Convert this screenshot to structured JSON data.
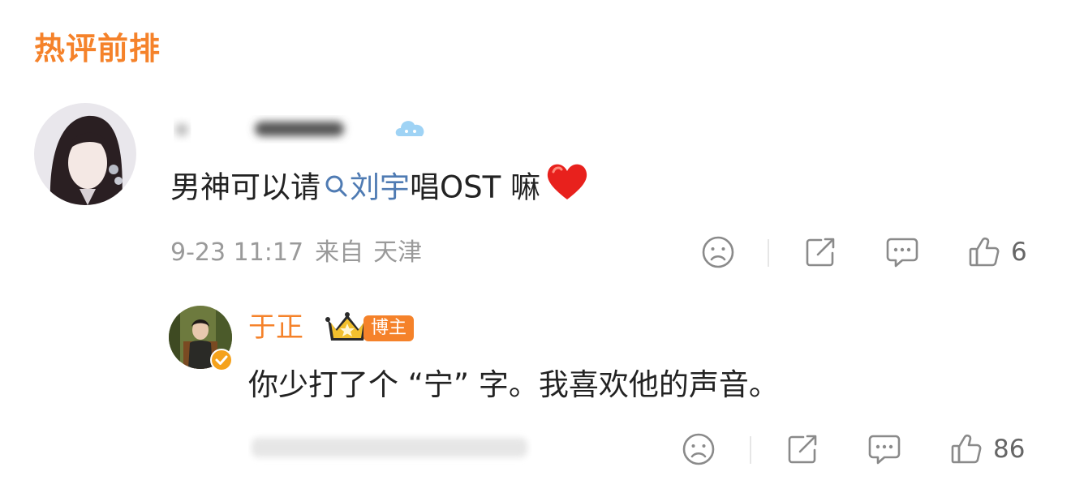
{
  "section": {
    "title": "热评前排"
  },
  "comment": {
    "text_prefix": "男神可以请",
    "link_text": "刘宇",
    "text_suffix": "唱OST 嘛",
    "time": "9-23 11:17",
    "location_label": "来自",
    "location": "天津",
    "like_count": "6"
  },
  "reply": {
    "author": "于正",
    "tag": "博主",
    "text": "你少打了个 “宁” 字。我喜欢他的声音。",
    "like_count": "86"
  },
  "icons": {
    "search": "search-icon",
    "heart": "heart-emoji-icon",
    "dislike": "sad-face-icon",
    "share": "share-icon",
    "comment": "comment-icon",
    "like": "thumbs-up-icon",
    "crown": "crown-icon",
    "verified": "verified-icon"
  },
  "colors": {
    "accent": "#f5822a",
    "link": "#4f7bb3",
    "meta": "#9a9a9a",
    "text": "#222222"
  }
}
